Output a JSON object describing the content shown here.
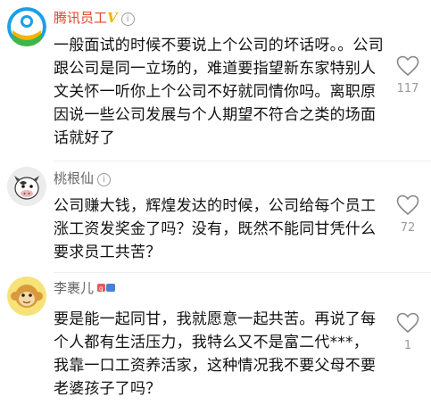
{
  "comments": [
    {
      "author": "腾讯员工",
      "verified_mark": "V",
      "author_color": "#e0452d",
      "text": "一般面试的时候不要说上个公司的坏话呀。。公司跟公司是同一立场的，难道要指望新东家特别人文关怀一听你上个公司不好就同情你吗。离职原因说一些公司发展与个人期望不符合之类的场面话就好了",
      "likes": "117",
      "avatar_icon": "tencent-logo-icon"
    },
    {
      "author": "桃根仙",
      "text": "公司赚大钱，辉煌发达的时候，公司给每个员工涨工资发奖金了吗？没有，既然不能同甘凭什么要求员工共苦？",
      "likes": "72",
      "avatar_icon": "cow-avatar-icon"
    },
    {
      "author": "李裹儿",
      "text": "要是能一起同甘，我就愿意一起共苦。再说了每个人都有生活压力，我特么又不是富二代***，我靠一口工资养活家，这种情况我不要父母不要老婆孩子了吗？",
      "likes": "1",
      "avatar_icon": "monkey-avatar-icon"
    }
  ]
}
